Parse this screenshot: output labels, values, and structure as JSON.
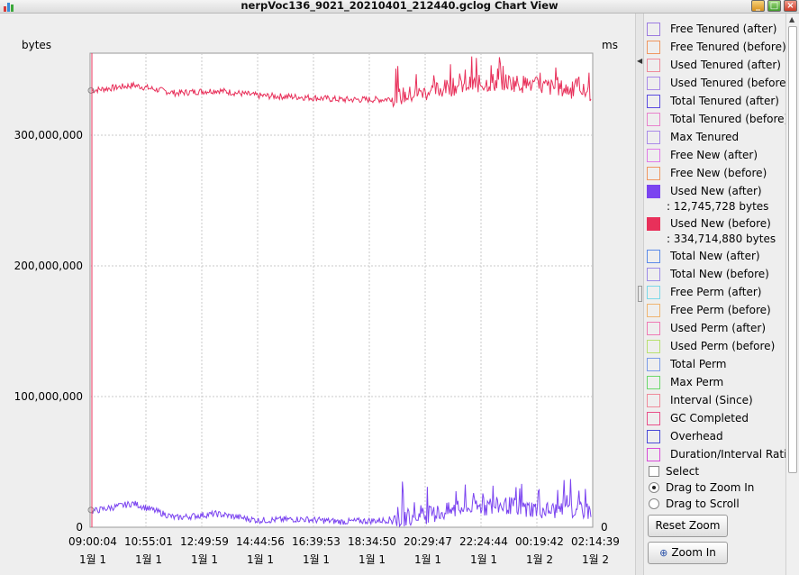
{
  "window": {
    "title": "nerpVoc136_9021_20210401_212440.gclog Chart View",
    "app_icon": "bar-chart-icon",
    "controls": [
      "minimize-icon",
      "maximize-icon",
      "close-icon"
    ]
  },
  "chart": {
    "y_left_unit": "bytes",
    "y_right_unit": "ms",
    "y_right_zero": "0",
    "y_ticks": [
      "0",
      "100,000,000",
      "200,000,000",
      "300,000,000"
    ],
    "x_times": [
      "09:00:04",
      "10:55:01",
      "12:49:59",
      "14:44:56",
      "16:39:53",
      "18:34:50",
      "20:29:47",
      "22:24:44",
      "00:19:42",
      "02:14:39"
    ],
    "x_dates": [
      "1월 1",
      "1월 1",
      "1월 1",
      "1월 1",
      "1월 1",
      "1월 1",
      "1월 1",
      "1월 1",
      "1월 2",
      "1월 2"
    ]
  },
  "chart_data": {
    "type": "line",
    "y_unit": "bytes",
    "ylim": [
      0,
      300000000
    ],
    "grid": true,
    "x_labels": [
      "09:00:04",
      "10:55:01",
      "12:49:59",
      "14:44:56",
      "16:39:53",
      "18:34:50",
      "20:29:47",
      "22:24:44",
      "00:19:42",
      "02:14:39"
    ],
    "series": [
      {
        "name": "Used New (before)",
        "color": "#e8305a",
        "values": [
          334000000,
          338000000,
          332000000,
          334000000,
          330000000,
          329000000,
          327000000,
          327000000,
          332000000,
          338000000,
          340000000,
          336000000,
          332000000
        ]
      },
      {
        "name": "Used New (after)",
        "color": "#7b44f0",
        "values": [
          12000000,
          18000000,
          7000000,
          10000000,
          5000000,
          6000000,
          4000000,
          5000000,
          8000000,
          14000000,
          16000000,
          12000000,
          12745728
        ]
      }
    ]
  },
  "legend": {
    "items": [
      {
        "label": "Free Tenured (after)",
        "color": "#9b7be0",
        "filled": false
      },
      {
        "label": "Free Tenured (before)",
        "color": "#ef9660",
        "filled": false
      },
      {
        "label": "Used Tenured (after)",
        "color": "#ef8a9a",
        "filled": false
      },
      {
        "label": "Used Tenured (before)",
        "color": "#a98ae8",
        "filled": false
      },
      {
        "label": "Total Tenured (after)",
        "color": "#5a4ae0",
        "filled": false
      },
      {
        "label": "Total Tenured (before)",
        "color": "#e882cc",
        "filled": false
      },
      {
        "label": "Max Tenured",
        "color": "#a98ae8",
        "filled": false
      },
      {
        "label": "Free New (after)",
        "color": "#e07ae8",
        "filled": false
      },
      {
        "label": "Free New (before)",
        "color": "#ef9660",
        "filled": false
      },
      {
        "label": "Used New (after)",
        "color": "#7b44f0",
        "filled": true,
        "readout": ": 12,745,728 bytes"
      },
      {
        "label": "Used New (before)",
        "color": "#e8305a",
        "filled": true,
        "readout": ": 334,714,880 bytes"
      },
      {
        "label": "Total New (after)",
        "color": "#5a8ae8",
        "filled": false
      },
      {
        "label": "Total New (before)",
        "color": "#9b8ae8",
        "filled": false
      },
      {
        "label": "Free Perm (after)",
        "color": "#7ad8e8",
        "filled": false
      },
      {
        "label": "Free Perm (before)",
        "color": "#efb470",
        "filled": false
      },
      {
        "label": "Used Perm (after)",
        "color": "#ef7ab4",
        "filled": false
      },
      {
        "label": "Used Perm (before)",
        "color": "#b8e070",
        "filled": false
      },
      {
        "label": "Total Perm",
        "color": "#7a9ae8",
        "filled": false
      },
      {
        "label": "Max Perm",
        "color": "#6ad86a",
        "filled": false
      },
      {
        "label": "Interval (Since)",
        "color": "#ef8a9a",
        "filled": false
      },
      {
        "label": "GC Completed",
        "color": "#e8508a",
        "filled": false
      },
      {
        "label": "Overhead",
        "color": "#4a4ad8",
        "filled": false
      },
      {
        "label": "Duration/Interval Ratio",
        "color": "#d84ad8",
        "filled": false
      }
    ]
  },
  "controls": {
    "select_label": "Select",
    "zoom_mode_label": "Drag to Zoom In",
    "scroll_mode_label": "Drag to Scroll",
    "reset_zoom_label": "Reset Zoom",
    "zoom_in_label": "Zoom In",
    "zoom_in_icon": "magnifier-zoom-icon",
    "selected_mode": "zoom"
  }
}
